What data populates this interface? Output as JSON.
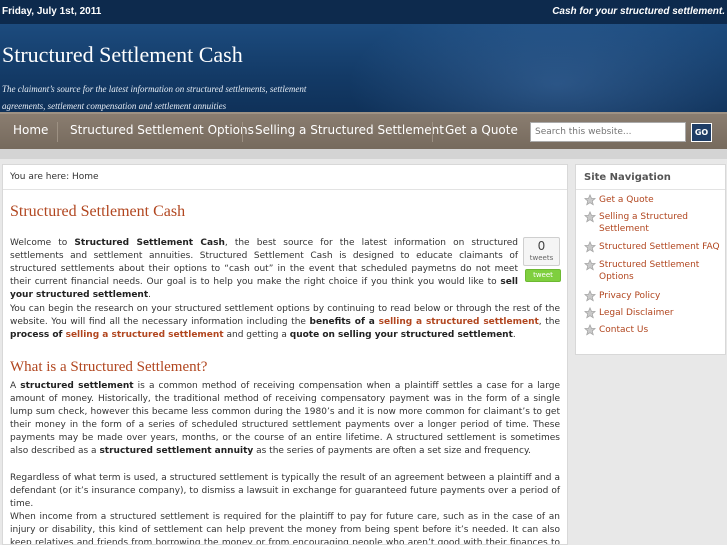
{
  "topbar": {
    "date": "Friday, July 1st, 2011",
    "slogan": "Cash for your structured settlement."
  },
  "header": {
    "site_title": "Structured Settlement Cash",
    "tagline": "The claimant’s source for the latest information on structured settlements, settlement agreements, settlement compensation and settlement annuities"
  },
  "nav": {
    "items": [
      "Home",
      "Structured Settlement Options",
      "Selling a Structured Settlement",
      "Get a Quote"
    ],
    "search_placeholder": "Search this website...",
    "search_button": "GO"
  },
  "breadcrumb": "You are here: Home",
  "main": {
    "title": "Structured Settlement Cash",
    "intro": {
      "welcome": "Welcome  to ",
      "brand": "Structured Settlement Cash",
      "body": ", the best source for the latest information on structured settlements and settlement annuities.  Structured Settlement Cash is designed to educate claimants of structured settlements about their options to “cash out” in the event that scheduled paymetns do not meet their current financial needs.  Our goal is to help you make the right choice if you think you would like to ",
      "sell": "sell your structured settlement",
      "end": "."
    },
    "research": {
      "p1": "You can begin the research on your structured settlement options by continuing to read below or through the rest of the website.  You will find all the necessary information including the ",
      "benefits": "benefits of a ",
      "link1": "selling a structured settlement",
      "comma": ", the ",
      "process": "process of ",
      "link2": "selling a structured settlement",
      "and": " and getting a ",
      "quote": "quote on selling your structured settlement",
      "end": "."
    },
    "h2": "What is a Structured Settlement?",
    "what": {
      "a": "A ",
      "ss": "structured settlement",
      "p1": " is a common method of receiving compensation when a plaintiff settles a case for a large amount of money.  Historically, the traditional method of receiving compensatory payment was in the form of a single lump sum check, however this became less common during the 1980’s and it is now more common for claimant’s to get their money in the form of a series of scheduled structured settlement payments over a longer period of time.  These payments may be made over years, months, or the course of an entire lifetime.  A structured settlement is sometimes also described as a ",
      "ssa": "structured settlement annuity",
      "p2": " as the series of payments are often a set size and frequency."
    },
    "regardless": "Regardless of what term is used, a structured settlement is typically the result of an agreement between a plaintiff and a defendant (or it’s insurance company), to dismiss a lawsuit in exchange for guaranteed future payments over a period of time.",
    "when": "When income from a structured settlement is required for the plaintiff to pay for future care, such as in the case of an injury or disability, this kind of settlement can help prevent the money from being spent before it’s needed.  It can also keep relatives and friends from borrowing the money or from encouraging people who aren’t good with their finances to spend their whole cash settlement at once."
  },
  "tweet": {
    "count": "0",
    "label": "tweets",
    "button": "tweet"
  },
  "sidebar": {
    "title": "Site Navigation",
    "items": [
      "Get a Quote",
      "Selling a Structured Settlement",
      "Structured Settlement FAQ",
      "Structured Settlement Options",
      "Privacy Policy",
      "Legal Disclaimer",
      "Contact Us"
    ]
  },
  "colors": {
    "accent": "#b1461f",
    "header": "#133a66",
    "nav": "#7f7366",
    "tweet": "#7fcf3f"
  }
}
